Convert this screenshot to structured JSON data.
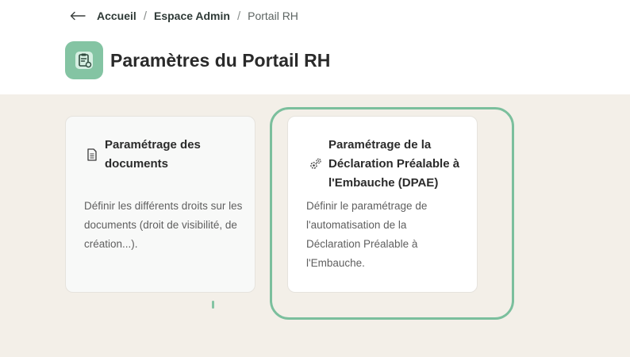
{
  "breadcrumb": {
    "items": [
      "Accueil",
      "Espace Admin",
      "Portail RH"
    ],
    "separator": "/"
  },
  "page": {
    "title": "Paramètres du Portail RH",
    "icon": "clipboard-settings-icon",
    "accent_color": "#84c4a3"
  },
  "cards": [
    {
      "title": "Paramétrage des documents",
      "description": "Définir les différents droits sur les documents (droit de visibilité, de création...).",
      "icon": "document-icon"
    },
    {
      "title": "Paramétrage de la Déclaration Préalable à l'Embauche (DPAE)",
      "description": "Définir le paramétrage de l'automatisation de la Déclaration Préalable à l'Embauche.",
      "icon": "gears-icon",
      "focused": true
    }
  ]
}
